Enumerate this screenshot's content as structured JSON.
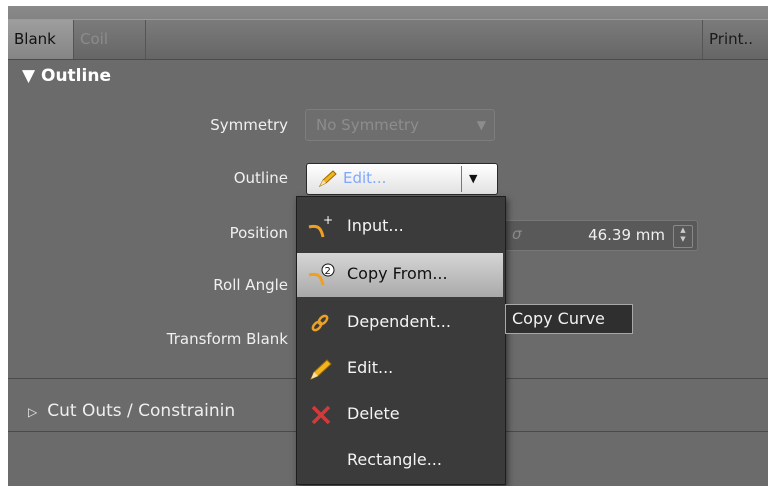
{
  "tabs": {
    "blank": "Blank",
    "coil": "Coil",
    "print": "Print.."
  },
  "outline_section": {
    "title": "Outline",
    "symmetry_label": "Symmetry",
    "symmetry_value": "No Symmetry",
    "outline_label": "Outline",
    "outline_button": "Edit...",
    "position_label": "Position",
    "position_symbol": "σ",
    "position_value": "46.39 mm",
    "roll_angle_label": "Roll Angle",
    "transform_label": "Transform Blank"
  },
  "cutouts_section": {
    "title": "Cut Outs / Constrainin"
  },
  "context_menu": {
    "items": [
      {
        "label": "Input...",
        "icon": "input-curve-icon"
      },
      {
        "label": "Copy From...",
        "icon": "copy-curve-icon"
      },
      {
        "label": "Dependent...",
        "icon": "link-icon"
      },
      {
        "label": "Edit...",
        "icon": "pencil-icon"
      },
      {
        "label": "Delete",
        "icon": "delete-x-icon"
      },
      {
        "label": "Rectangle...",
        "icon": ""
      }
    ],
    "highlighted_index": 1
  },
  "tooltip": "Copy Curve",
  "colors": {
    "panel": "#6b6b6b",
    "menu": "#3b3b3b",
    "accent_text": "#7fa7ff",
    "delete_red": "#d33a3a",
    "icon_orange": "#f0a020"
  }
}
